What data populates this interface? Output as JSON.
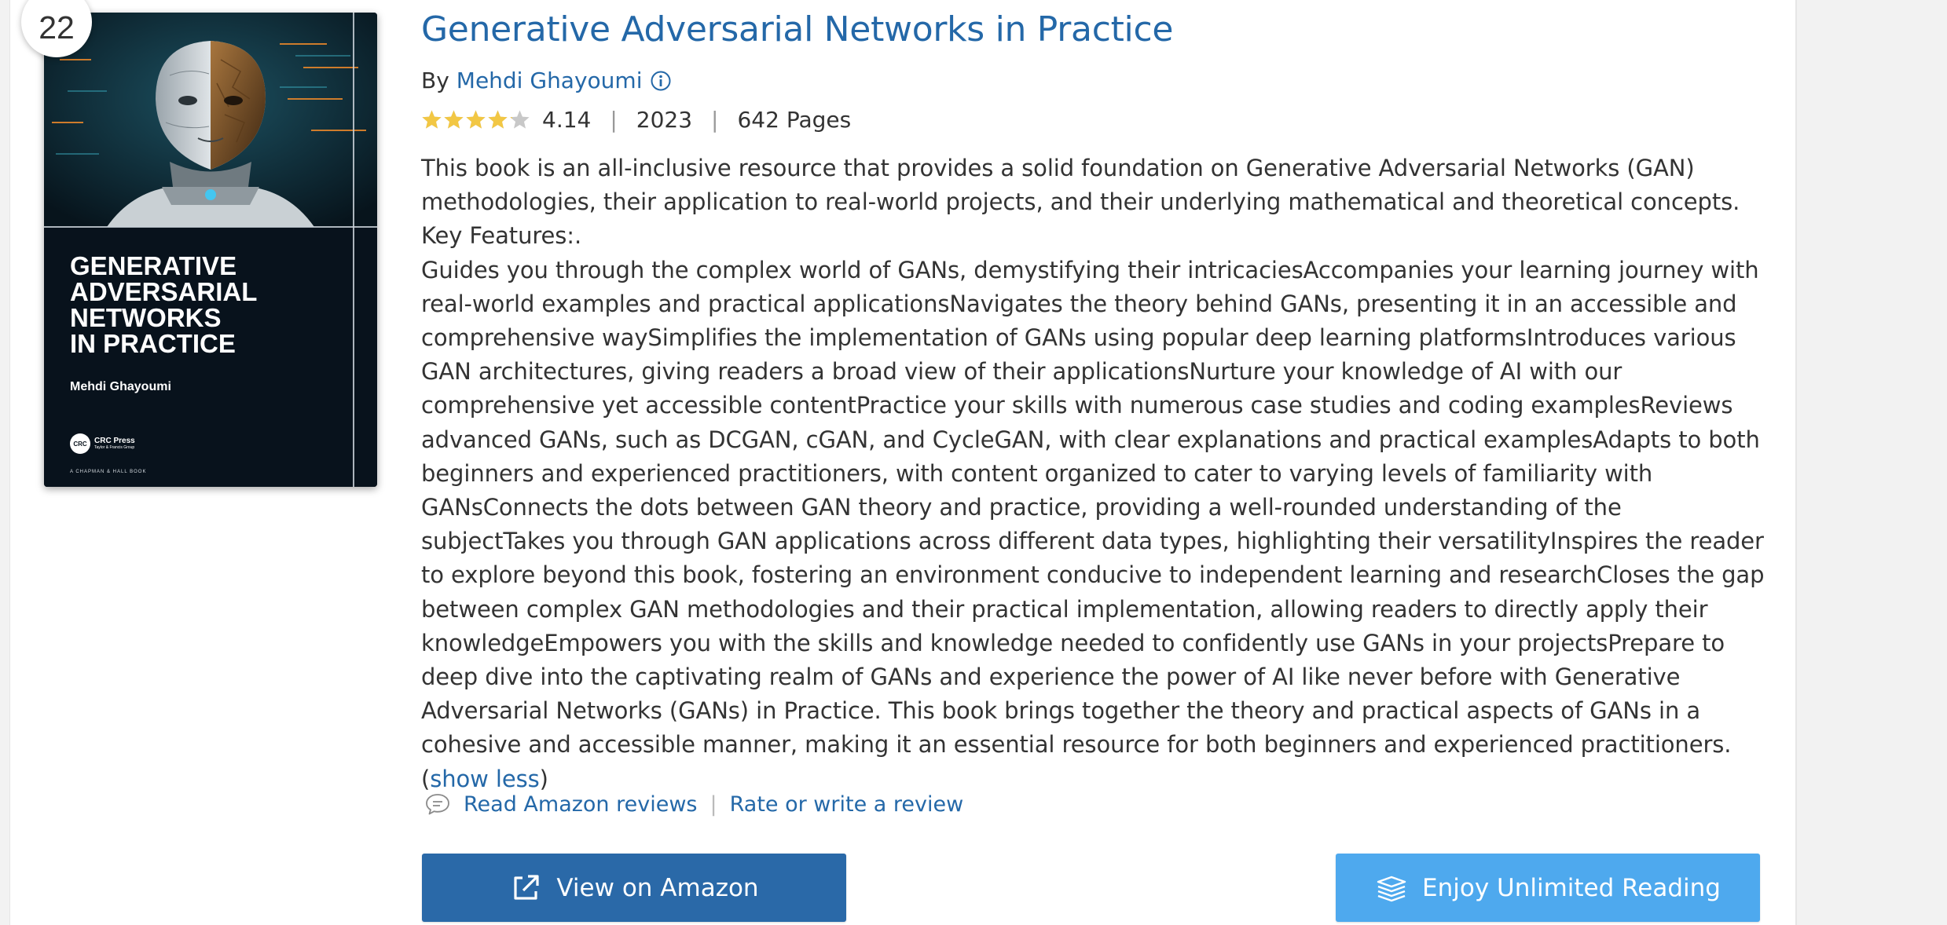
{
  "rank": "22",
  "cover": {
    "title": "Generative\nAdversarial\nNetworks\nin Practice",
    "author": "Mehdi Ghayoumi",
    "publisher_logo": "CRC",
    "publisher_name": "CRC Press",
    "publisher_group": "Taylor & Francis Group",
    "imprint": "A CHAPMAN & HALL BOOK"
  },
  "book": {
    "title": "Generative Adversarial Networks in Practice",
    "by_label": "By",
    "author": "Mehdi Ghayoumi",
    "rating": "4.14",
    "rating_value": 4.14,
    "rating_max": 5,
    "year": "2023",
    "pages": "642 Pages"
  },
  "description": {
    "intro": "This book is an all-inclusive resource that provides a solid foundation on Generative Adversarial Networks (GAN) methodologies, their application to real-world projects, and their underlying mathematical and theoretical concepts. Key Features:.",
    "body": "Guides you through the complex world of GANs, demystifying their intricaciesAccompanies your learning journey with real-world examples and practical applicationsNavigates the theory behind GANs, presenting it in an accessible and comprehensive waySimplifies the implementation of GANs using popular deep learning platformsIntroduces various GAN architectures, giving readers a broad view of their applicationsNurture your knowledge of AI with our comprehensive yet accessible contentPractice your skills with numerous case studies and coding examplesReviews advanced GANs, such as DCGAN, cGAN, and CycleGAN, with clear explanations and practical examplesAdapts to both beginners and experienced practitioners, with content organized to cater to varying levels of familiarity with GANsConnects the dots between GAN theory and practice, providing a well-rounded understanding of the subjectTakes you through GAN applications across different data types, highlighting their versatilityInspires the reader to explore beyond this book, fostering an environment conducive to independent learning and researchCloses the gap between complex GAN methodologies and their practical implementation, allowing readers to directly apply their knowledgeEmpowers you with the skills and knowledge needed to confidently use GANs in your projectsPrepare to deep dive into the captivating realm of GANs and experience the power of AI like never before with Generative Adversarial Networks (GANs) in Practice. This book brings together the theory and practical aspects of GANs in a cohesive and accessible manner, making it an essential resource for both beginners and experienced practitioners.",
    "show_less_open": " (",
    "show_less": "show less",
    "show_less_close": ")"
  },
  "reviews": {
    "read_label": "Read Amazon reviews",
    "separator": "|",
    "rate_label": "Rate or write a review"
  },
  "buttons": {
    "amazon": "View on Amazon",
    "unlimited": "Enjoy Unlimited Reading"
  },
  "colors": {
    "link": "#2468a8",
    "amazon_button": "#2a69a8",
    "unlimited_button": "#4ea9ee",
    "star_filled": "#f2c744",
    "star_empty": "#c8c8c8"
  },
  "icons": {
    "info": "info-circle-icon",
    "chat": "chat-bubble-icon",
    "external": "external-link-icon",
    "stack": "book-stack-icon"
  }
}
